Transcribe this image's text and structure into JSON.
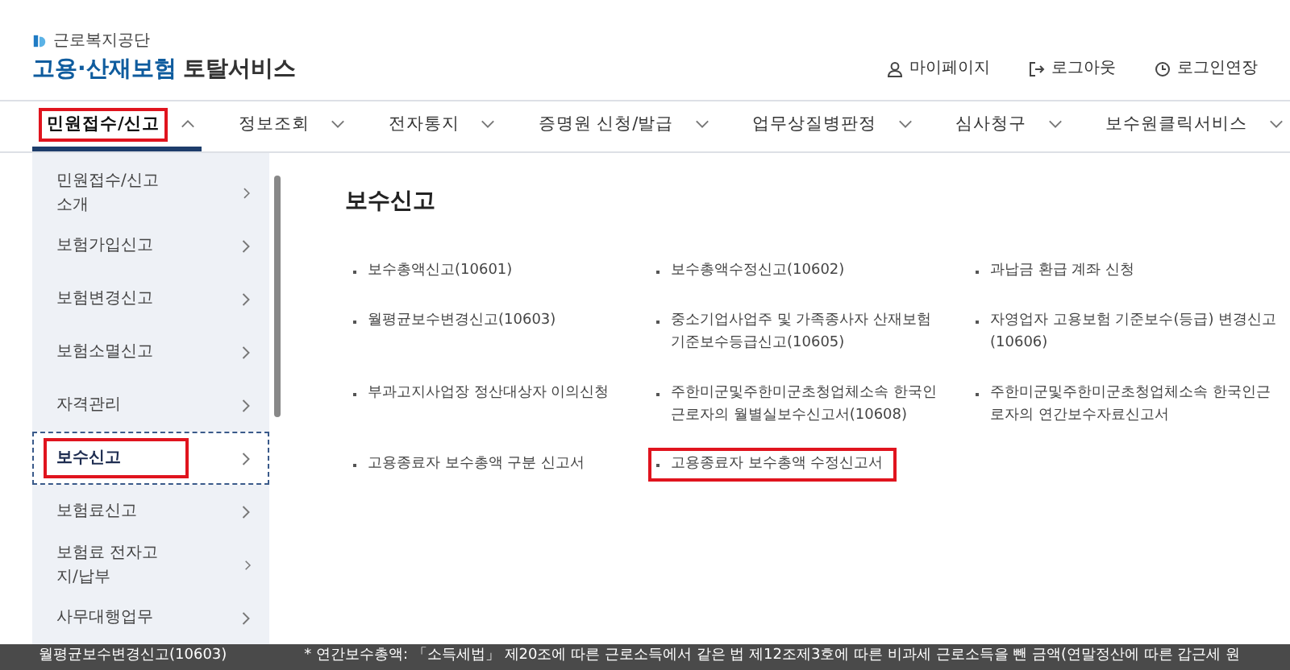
{
  "header": {
    "org": "근로복지공단",
    "title_main": "고용·산재보험",
    "title_rest": "토탈서비스",
    "links": [
      {
        "kind": "user",
        "label": "마이페이지"
      },
      {
        "kind": "logout",
        "label": "로그아웃"
      },
      {
        "kind": "clock",
        "label": "로그인연장"
      }
    ]
  },
  "nav": [
    {
      "label": "민원접수/신고",
      "selected": true,
      "expanded": true,
      "highlighted": true
    },
    {
      "label": "정보조회",
      "selected": false,
      "expanded": false,
      "highlighted": false
    },
    {
      "label": "전자통지",
      "selected": false,
      "expanded": false,
      "highlighted": false
    },
    {
      "label": "증명원 신청/발급",
      "selected": false,
      "expanded": false,
      "highlighted": false
    },
    {
      "label": "업무상질병판정",
      "selected": false,
      "expanded": false,
      "highlighted": false
    },
    {
      "label": "심사청구",
      "selected": false,
      "expanded": false,
      "highlighted": false
    },
    {
      "label": "보수원클릭서비스",
      "selected": false,
      "expanded": false,
      "highlighted": false
    }
  ],
  "sidebar": [
    {
      "label": "민원접수/신고 소개",
      "selected": false,
      "highlighted": false
    },
    {
      "label": "보험가입신고",
      "selected": false,
      "highlighted": false
    },
    {
      "label": "보험변경신고",
      "selected": false,
      "highlighted": false
    },
    {
      "label": "보험소멸신고",
      "selected": false,
      "highlighted": false
    },
    {
      "label": "자격관리",
      "selected": false,
      "highlighted": false
    },
    {
      "label": "보수신고",
      "selected": true,
      "highlighted": true
    },
    {
      "label": "보험료신고",
      "selected": false,
      "highlighted": false
    },
    {
      "label": "보험료 전자고지/납부",
      "selected": false,
      "highlighted": false
    },
    {
      "label": "사무대행업무",
      "selected": false,
      "highlighted": false
    }
  ],
  "content": {
    "title": "보수신고",
    "items": [
      {
        "text": "보수총액신고(10601)",
        "highlighted": false
      },
      {
        "text": "보수총액수정신고(10602)",
        "highlighted": false
      },
      {
        "text": "과납금 환급 계좌 신청",
        "highlighted": false
      },
      {
        "text": "월평균보수변경신고(10603)",
        "highlighted": false
      },
      {
        "text": "중소기업사업주 및 가족종사자 산재보험 기준보수등급신고(10605)",
        "highlighted": false
      },
      {
        "text": "자영업자 고용보험 기준보수(등급) 변경신고(10606)",
        "highlighted": false
      },
      {
        "text": "부과고지사업장 정산대상자 이의신청",
        "highlighted": false
      },
      {
        "text": "주한미군및주한미군초청업체소속 한국인근로자의 월별실보수신고서(10608)",
        "highlighted": false
      },
      {
        "text": "주한미군및주한미군초청업체소속 한국인근로자의 연간보수자료신고서",
        "highlighted": false
      },
      {
        "text": "고용종료자 보수총액 구분 신고서",
        "highlighted": false
      },
      {
        "text": "고용종료자 보수총액 수정신고서",
        "highlighted": true
      }
    ]
  },
  "overlay_bar": {
    "left": "월평균보수변경신고(10603)",
    "right": "* 연간보수총액: 「소득세법」 제20조에 따른 근로소득에서 같은 법 제12조제3호에 따른 비과세 근로소득을 뺀 금액(연말정산에 따른 갑근세 원"
  }
}
